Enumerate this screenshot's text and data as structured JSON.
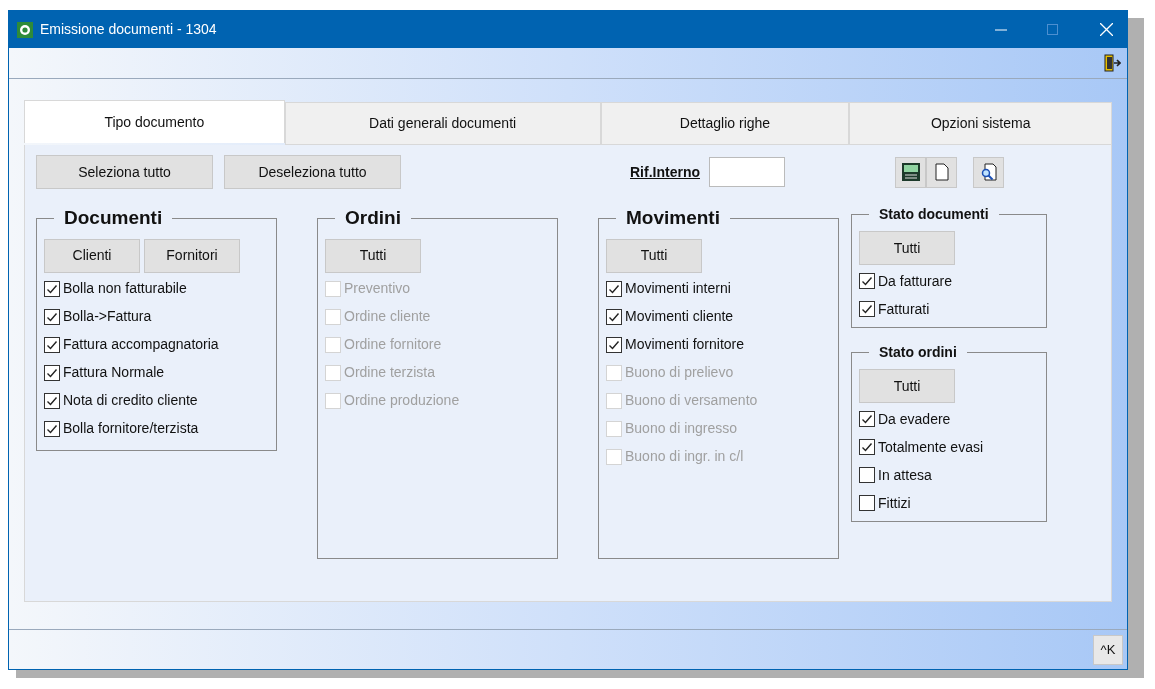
{
  "window": {
    "title": "Emissione documenti - 1304"
  },
  "tabs": [
    {
      "label": "Tipo documento",
      "selected": true
    },
    {
      "label": "Dati generali documenti",
      "selected": false
    },
    {
      "label": "Dettaglio righe",
      "selected": false
    },
    {
      "label": "Opzioni sistema",
      "selected": false
    }
  ],
  "actions": [
    "Seleziona tutto",
    "Deseleziona tutto"
  ],
  "rif_interno": {
    "label": "Rif.Interno"
  },
  "groups": [
    {
      "title": "Documenti",
      "kind": "main",
      "buttons": [
        "Clienti",
        "Fornitori"
      ],
      "items": [
        {
          "label": "Bolla non fatturabile",
          "checked": true,
          "disabled": false
        },
        {
          "label": "Bolla->Fattura",
          "checked": true,
          "disabled": false
        },
        {
          "label": "Fattura accompagnatoria",
          "checked": true,
          "disabled": false
        },
        {
          "label": "Fattura Normale",
          "checked": true,
          "disabled": false
        },
        {
          "label": "Nota di credito cliente",
          "checked": true,
          "disabled": false
        },
        {
          "label": "Bolla fornitore/terzista",
          "checked": true,
          "disabled": false
        }
      ]
    },
    {
      "title": "Ordini",
      "kind": "main",
      "buttons": [
        "Tutti"
      ],
      "items": [
        {
          "label": "Preventivo",
          "checked": false,
          "disabled": true
        },
        {
          "label": "Ordine cliente",
          "checked": false,
          "disabled": true
        },
        {
          "label": "Ordine fornitore",
          "checked": false,
          "disabled": true
        },
        {
          "label": "Ordine terzista",
          "checked": false,
          "disabled": true
        },
        {
          "label": "Ordine produzione",
          "checked": false,
          "disabled": true
        }
      ]
    },
    {
      "title": "Movimenti",
      "kind": "main",
      "buttons": [
        "Tutti"
      ],
      "items": [
        {
          "label": "Movimenti interni",
          "checked": true,
          "disabled": false
        },
        {
          "label": "Movimenti cliente",
          "checked": true,
          "disabled": false
        },
        {
          "label": "Movimenti fornitore",
          "checked": true,
          "disabled": false
        },
        {
          "label": "Buono di prelievo",
          "checked": false,
          "disabled": true
        },
        {
          "label": "Buono di versamento",
          "checked": false,
          "disabled": true
        },
        {
          "label": "Buono di ingresso",
          "checked": false,
          "disabled": true
        },
        {
          "label": "Buono di ingr. in c/l",
          "checked": false,
          "disabled": true
        }
      ]
    },
    {
      "title": "Stato documenti",
      "kind": "status",
      "buttons": [
        "Tutti"
      ],
      "items": [
        {
          "label": "Da fatturare",
          "checked": true,
          "disabled": false
        },
        {
          "label": "Fatturati",
          "checked": true,
          "disabled": false
        }
      ]
    },
    {
      "title": "Stato ordini",
      "kind": "status",
      "buttons": [
        "Tutti"
      ],
      "items": [
        {
          "label": "Da evadere",
          "checked": true,
          "disabled": false
        },
        {
          "label": "Totalmente evasi",
          "checked": true,
          "disabled": false
        },
        {
          "label": "In attesa",
          "checked": false,
          "disabled": false
        },
        {
          "label": "Fittizi",
          "checked": false,
          "disabled": false
        }
      ]
    }
  ],
  "shortcut_button": "^K"
}
